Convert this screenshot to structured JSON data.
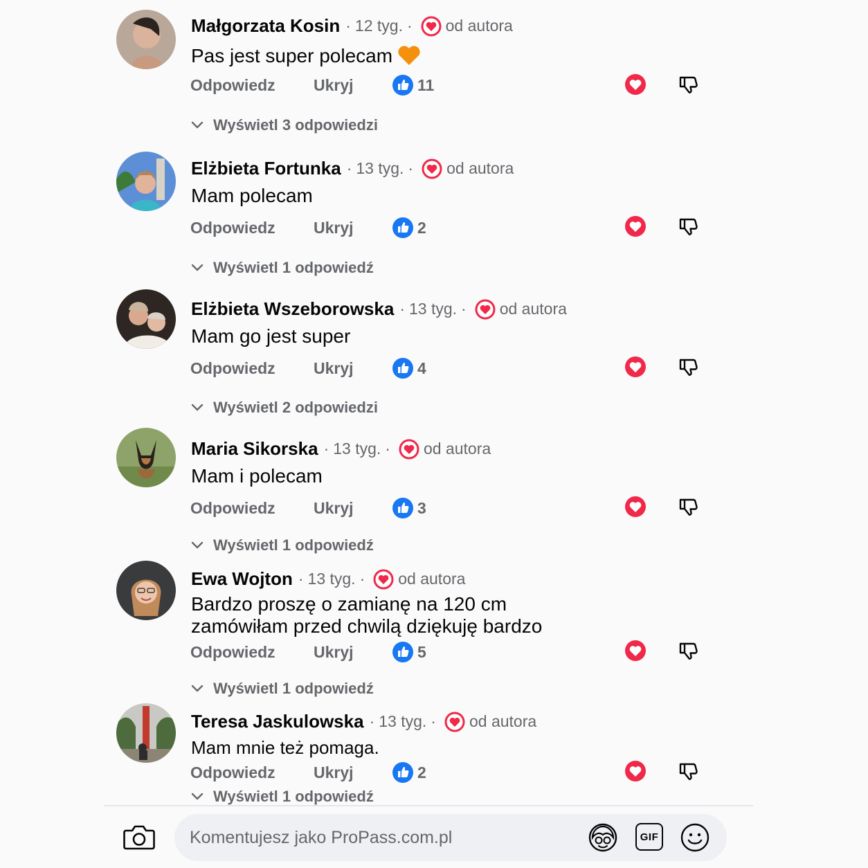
{
  "comments": [
    {
      "author": "Małgorzata Kosin",
      "time": "12 tyg.",
      "badge": "od autora",
      "text": "Pas jest super  polecam",
      "emoji": "orange-heart",
      "reply": "Odpowiedz",
      "hide": "Ukryj",
      "likes": "11",
      "replies": "Wyświetl 3 odpowiedzi"
    },
    {
      "author": "Elżbieta Fortunka",
      "time": "13 tyg.",
      "badge": "od autora",
      "text": "Mam polecam",
      "reply": "Odpowiedz",
      "hide": "Ukryj",
      "likes": "2",
      "replies": "Wyświetl 1 odpowiedź"
    },
    {
      "author": "Elżbieta Wszeborowska",
      "time": "13 tyg.",
      "badge": "od autora",
      "text": "Mam go jest super",
      "reply": "Odpowiedz",
      "hide": "Ukryj",
      "likes": "4",
      "replies": "Wyświetl 2 odpowiedzi"
    },
    {
      "author": "Maria Sikorska",
      "time": "13 tyg.",
      "badge": "od autora",
      "text": "Mam i polecam",
      "reply": "Odpowiedz",
      "hide": "Ukryj",
      "likes": "3",
      "replies": "Wyświetl 1 odpowiedź"
    },
    {
      "author": "Ewa Wojton",
      "time": "13 tyg.",
      "badge": "od autora",
      "text_line1": "Bardzo proszę o zamianę na 120 cm",
      "text_line2": "zamówiłam przed chwilą dziękuję bardzo",
      "reply": "Odpowiedz",
      "hide": "Ukryj",
      "likes": "5",
      "replies": "Wyświetl 1 odpowiedź"
    },
    {
      "author": "Teresa Jaskulowska",
      "time": "13 tyg.",
      "badge": "od autora",
      "text": "Mam mnie też pomaga.",
      "reply": "Odpowiedz",
      "hide": "Ukryj",
      "likes": "2",
      "replies": "Wyświetl 1 odpowiedź"
    }
  ],
  "composer": {
    "placeholder": "Komentujesz jako ProPass.com.pl",
    "gif_label": "GIF"
  },
  "colors": {
    "heart": "#f02849",
    "like_blue": "#1877f2",
    "muted_text": "#65676b",
    "orange_heart": "#f4900c"
  },
  "icons": [
    "camera-icon",
    "avatar-sticker-icon",
    "gif-icon",
    "smiley-icon",
    "heart-icon",
    "dislike-icon",
    "like-icon",
    "chevron-down-icon"
  ]
}
